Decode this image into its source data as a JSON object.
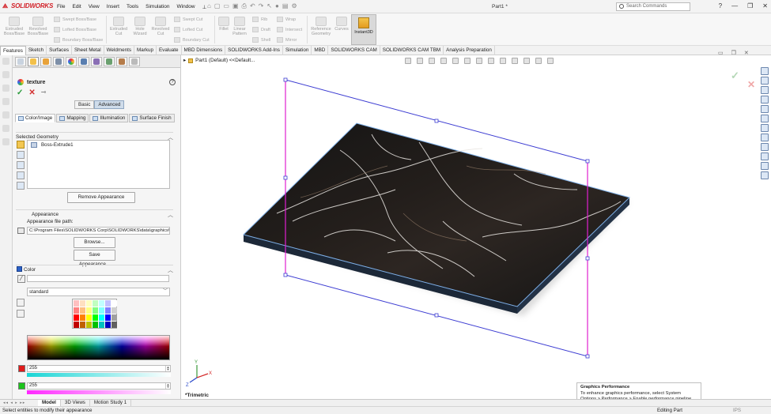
{
  "app": {
    "brand": "SOLIDWORKS",
    "menu": [
      "File",
      "Edit",
      "View",
      "Insert",
      "Tools",
      "Simulation",
      "Window"
    ],
    "doc_title": "Part1 *",
    "search_placeholder": "Search Commands"
  },
  "commands": {
    "extruded_boss": "Extruded\nBoss/Base",
    "revolved_boss": "Revolved\nBoss/Base",
    "swept_boss": "Swept Boss/Base",
    "lofted_boss": "Lofted Boss/Base",
    "boundary_boss": "Boundary Boss/Base",
    "extruded_cut": "Extruded\nCut",
    "hole_wizard": "Hole\nWizard",
    "revolved_cut": "Revolved\nCut",
    "swept_cut": "Swept Cut",
    "lofted_cut": "Lofted Cut",
    "boundary_cut": "Boundary Cut",
    "fillet": "Fillet",
    "linear_pattern": "Linear\nPattern",
    "rib": "Rib",
    "draft": "Draft",
    "shell": "Shell",
    "wrap": "Wrap",
    "intersect": "Intersect",
    "mirror": "Mirror",
    "reference_geometry": "Reference\nGeometry",
    "curves": "Curves",
    "instant3d": "Instant3D"
  },
  "tabs": [
    "Features",
    "Sketch",
    "Surfaces",
    "Sheet Metal",
    "Weldments",
    "Markup",
    "Evaluate",
    "MBD Dimensions",
    "SOLIDWORKS Add-Ins",
    "Simulation",
    "MBD",
    "SOLIDWORKS CAM",
    "SOLIDWORKS CAM TBM",
    "Analysis Preparation"
  ],
  "panel": {
    "title": "texture",
    "basic": "Basic",
    "advanced": "Advanced",
    "subtabs": [
      "Color/Image",
      "Mapping",
      "Illumination",
      "Surface Finish"
    ],
    "selected_geometry_header": "Selected Geometry",
    "selected_item": "Boss-Extrude1",
    "remove_appearance": "Remove Appearance",
    "appearance_header": "Appearance",
    "appearance_path_label": "Appearance file path:",
    "appearance_path": "C:\\Program Files\\SOLIDWORKS Corp\\SOLIDWORKS\\data\\graphics\\m",
    "browse": "Browse...",
    "save_appearance": "Save Appearance...",
    "color_header": "Color",
    "color_mode": "standard",
    "red_value": "255",
    "green_value": "255",
    "colors": {
      "accent_blue": "#2c62c9",
      "ok_green": "#2a9a3b",
      "cancel_red": "#d32f2f"
    }
  },
  "viewport": {
    "breadcrumb": "Part1 (Default) <<Default...",
    "view_name": "*Trimetric",
    "triad": {
      "x": "X",
      "y": "Y",
      "z": "Z"
    }
  },
  "bottom_tabs": [
    "Model",
    "3D Views",
    "Motion Study 1"
  ],
  "status": {
    "message": "Select entities to modify their appearance",
    "editing": "Editing Part",
    "units": "IPS"
  },
  "toast": {
    "title": "Graphics Performance",
    "body": "To enhance graphics performance, select System Options > Performance > Enable performance pipeline."
  }
}
